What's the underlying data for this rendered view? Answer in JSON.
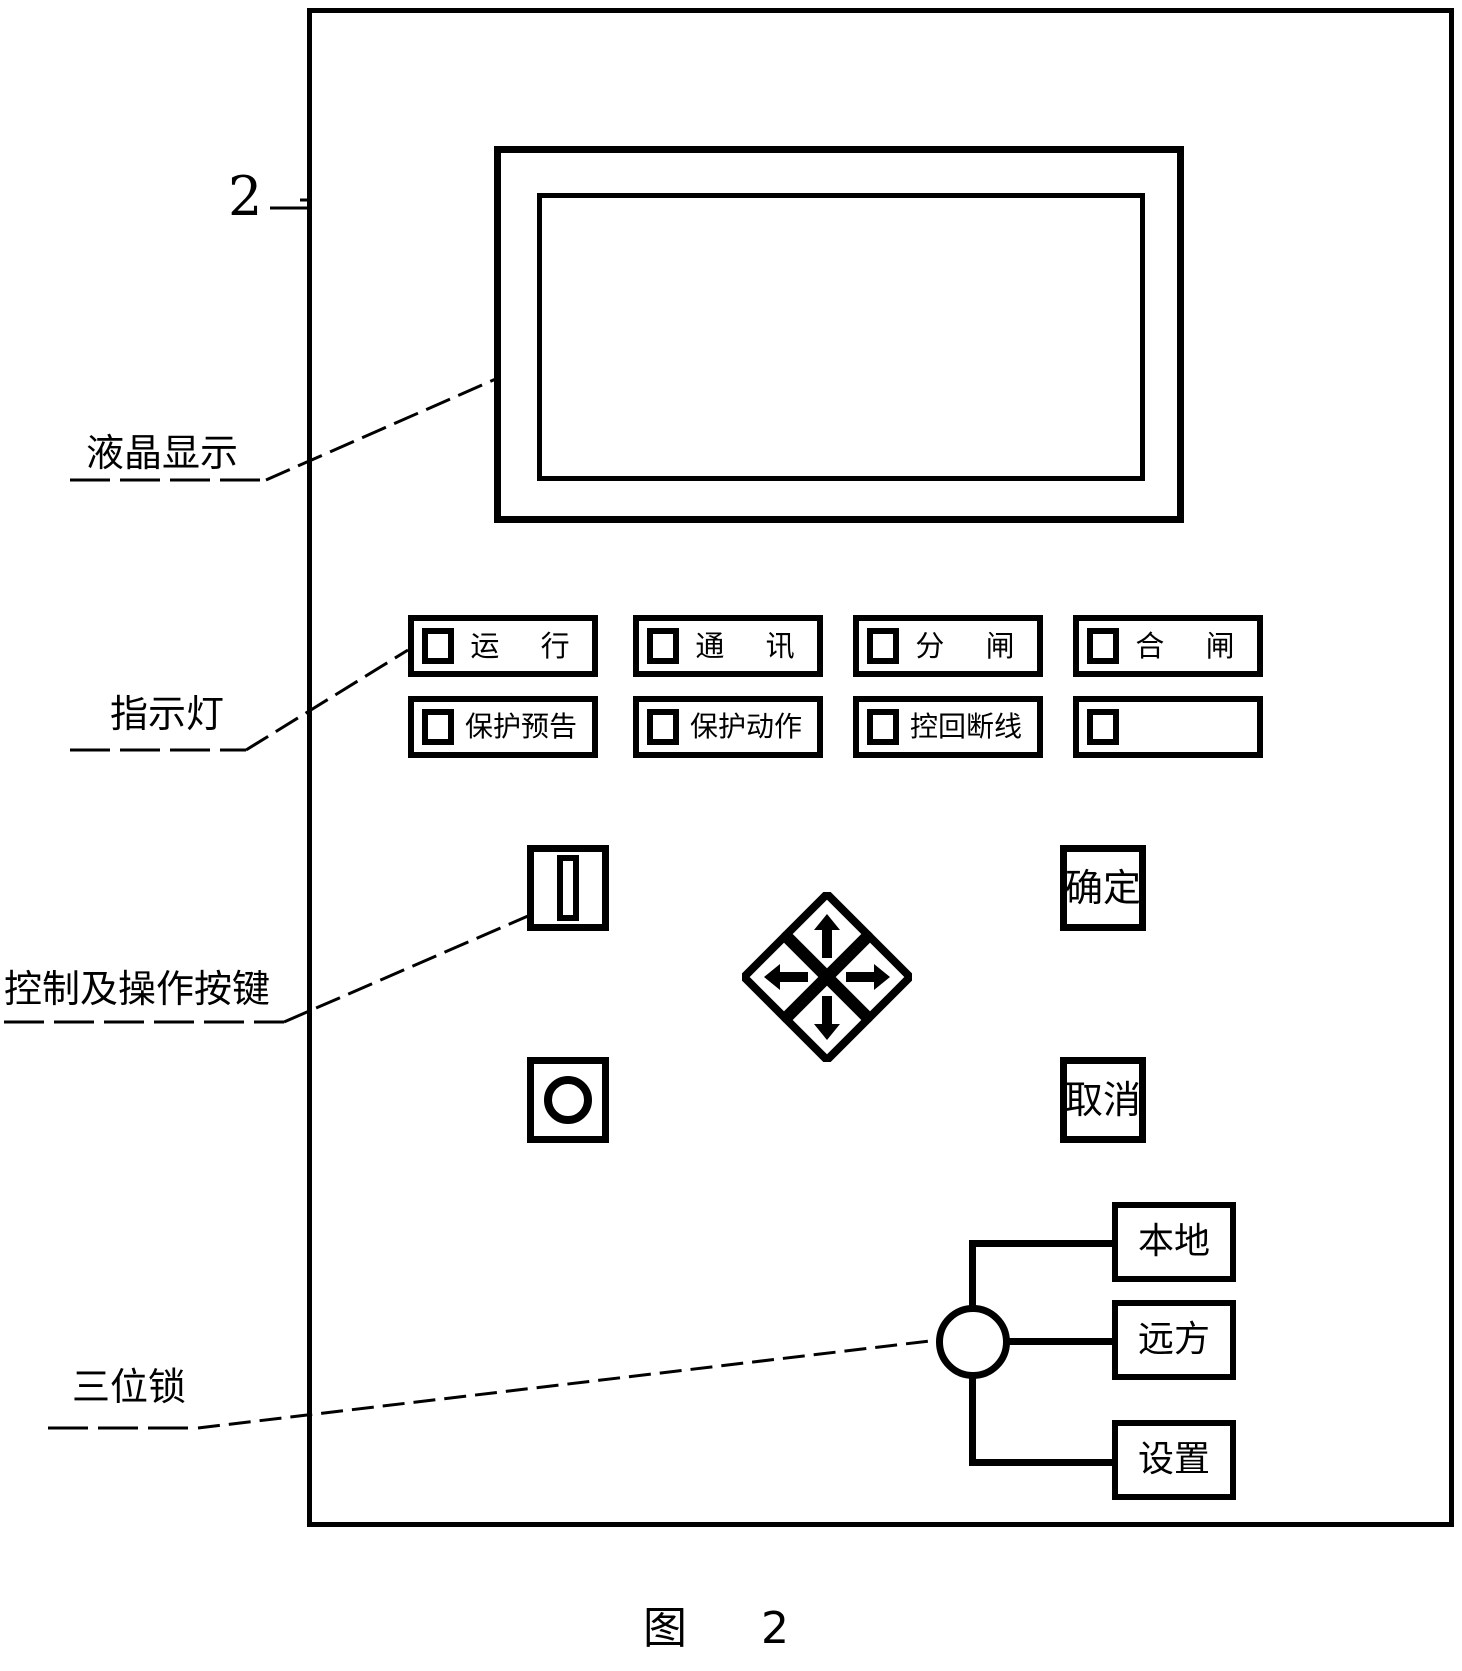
{
  "figure": {
    "caption": "图    2",
    "reference_number": "2"
  },
  "callouts": [
    {
      "text": "液晶显示",
      "name": "callout-lcd"
    },
    {
      "text": "指示灯",
      "name": "callout-indicator-lights"
    },
    {
      "text": "控制及操作按键",
      "name": "callout-control-keys"
    },
    {
      "text": "三位锁",
      "name": "callout-three-position-lock"
    }
  ],
  "indicators": {
    "row1": [
      {
        "label": "运 行",
        "name": "indicator-run"
      },
      {
        "label": "通 讯",
        "name": "indicator-comm"
      },
      {
        "label": "分 闸",
        "name": "indicator-trip"
      },
      {
        "label": "合 闸",
        "name": "indicator-close"
      }
    ],
    "row2": [
      {
        "label": "保护预告",
        "name": "indicator-protection-alarm"
      },
      {
        "label": "保护动作",
        "name": "indicator-protection-action"
      },
      {
        "label": "控回断线",
        "name": "indicator-control-loop-break"
      },
      {
        "label": "",
        "name": "indicator-spare"
      }
    ]
  },
  "keys": {
    "bar_key": {
      "glyph": "bar-glyph",
      "name": "open-breaker-key"
    },
    "circle_key": {
      "glyph": "circle-glyph",
      "name": "close-breaker-key"
    },
    "confirm": "确定",
    "cancel": "取消",
    "dpad": {
      "up": "arrow-up-icon",
      "down": "arrow-down-icon",
      "left": "arrow-left-icon",
      "right": "arrow-right-icon"
    }
  },
  "lock": {
    "positions": [
      {
        "label": "本地",
        "name": "lock-position-local"
      },
      {
        "label": "远方",
        "name": "lock-position-remote"
      },
      {
        "label": "设置",
        "name": "lock-position-setting"
      }
    ]
  },
  "colors": {
    "line": "#000000",
    "background": "#ffffff"
  }
}
